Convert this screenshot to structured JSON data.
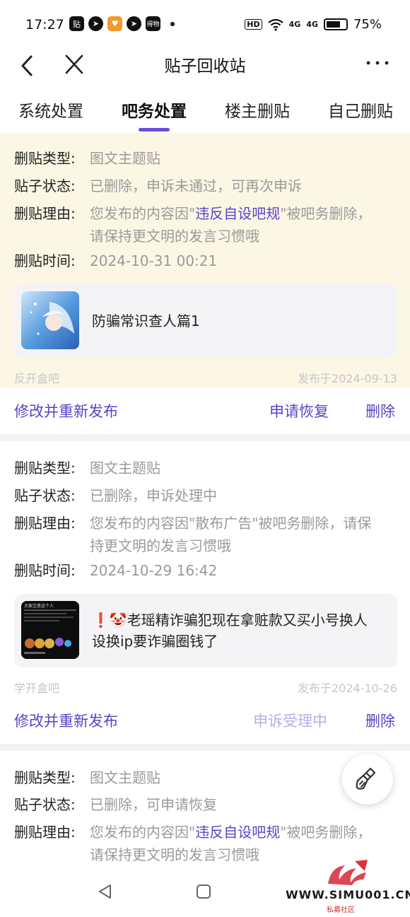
{
  "status_bar": {
    "time": "17:27",
    "left_icons": [
      "贴",
      "telegram",
      "heart",
      "telegram",
      "得物"
    ],
    "hd_label": "HD",
    "net1": "4G",
    "net2": "4G",
    "battery_percent": "75%",
    "battery_level": 0.75
  },
  "nav": {
    "title": "贴子回收站"
  },
  "tabs": [
    {
      "label": "系统处置"
    },
    {
      "label": "吧务处置"
    },
    {
      "label": "楼主删贴"
    },
    {
      "label": "自己删贴"
    }
  ],
  "active_tab": "吧务处置",
  "labels": {
    "type": "删贴类型:",
    "status": "贴子状态:",
    "reason": "删贴理由:",
    "time": "删贴时间:"
  },
  "cards": [
    {
      "type": "图文主题贴",
      "status": "已删除，申诉未通过，可再次申诉",
      "reason_prefix": "您发布的内容因\"",
      "reason_highlight": "违反自设吧规",
      "reason_suffix_line1": "\"被吧务删除，",
      "reason_line2": "请保持更文明的发言习惯哦",
      "time": "2024-10-31 00:21",
      "post_title": "防骗常识查人篇1",
      "forum": "反开盒吧",
      "published": "发布于2024-09-13",
      "actions": {
        "edit": "修改并重新发布",
        "appeal": "申请恢复",
        "delete": "删除"
      }
    },
    {
      "type": "图文主题贴",
      "status": "已删除，申诉处理中",
      "reason_line1": "您发布的内容因\"散布广告\"被吧务删除，请保",
      "reason_line2": "持更文明的发言习惯哦",
      "time": "2024-10-29 16:42",
      "post_title_line1": "❗🤡老瑶精诈骗犯现在拿赃款又买小号换人",
      "post_title_line2": "设换ip要诈骗圈钱了",
      "forum": "学开盒吧",
      "published": "发布于2024-10-26",
      "actions": {
        "edit": "修改并重新发布",
        "appeal": "申诉受理中",
        "delete": "删除"
      }
    },
    {
      "type": "图文主题贴",
      "status": "已删除，可申请恢复",
      "reason_prefix": "您发布的内容因\"",
      "reason_highlight": "违反自设吧规",
      "reason_suffix_line1": "\"被吧务删除，",
      "reason_line2": "请保持更文明的发言习惯哦"
    }
  ],
  "thumb2_caption": "大家注意这个人",
  "watermark": {
    "text": "WWW.SIMU001.CN",
    "sub": "私募社区"
  },
  "colors": {
    "accent": "#5a43c8",
    "indicator": "#6a4bd9",
    "highlight_bg": "#fbf7e4"
  }
}
